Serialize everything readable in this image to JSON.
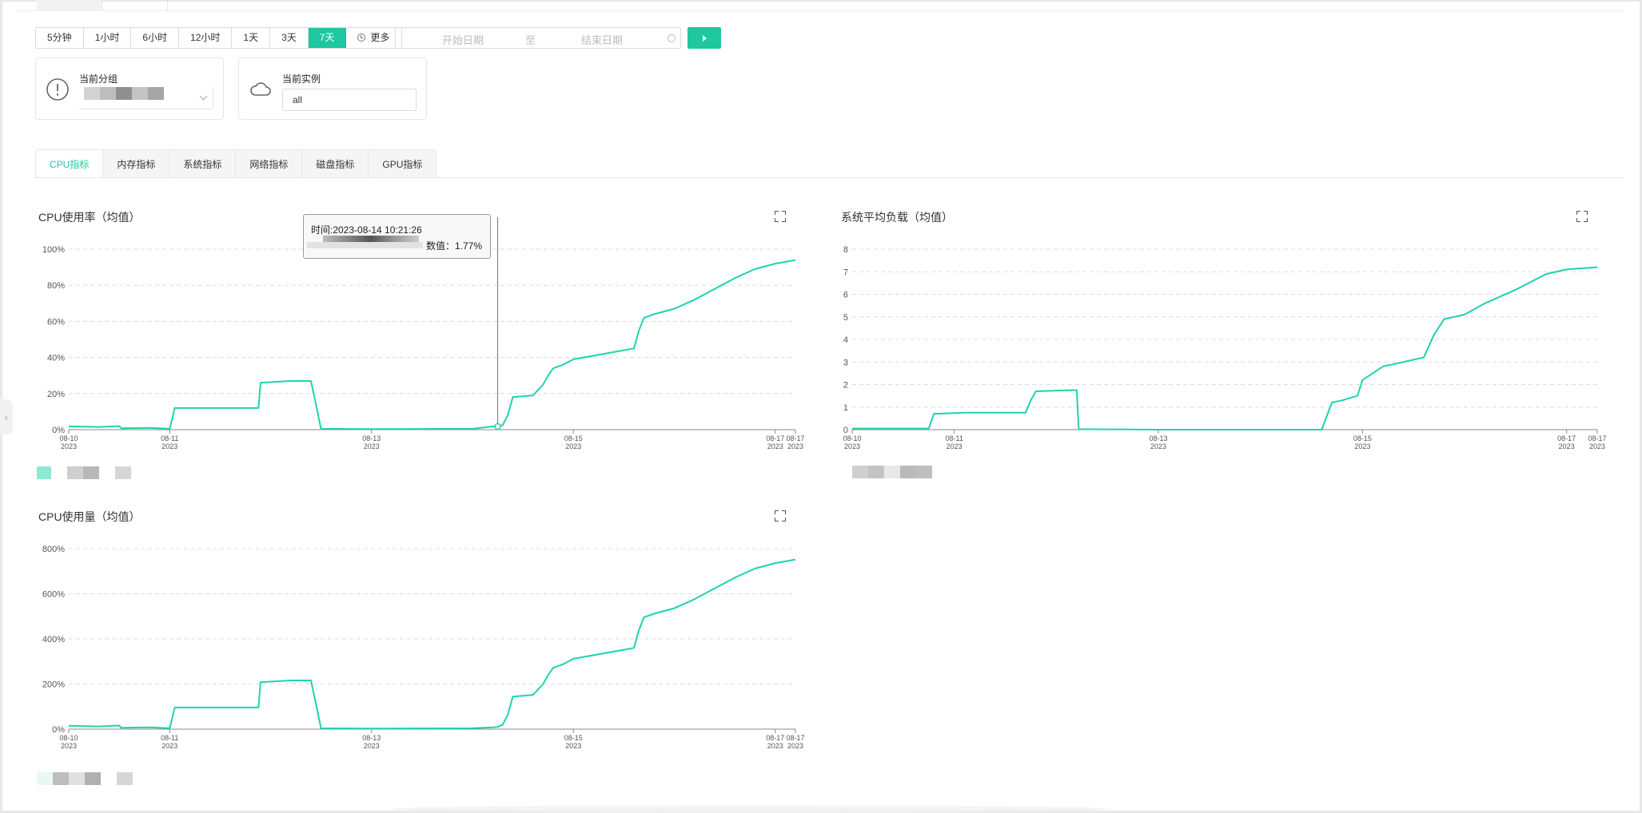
{
  "toolbar": {
    "ranges": [
      {
        "label": "5分钟",
        "active": false
      },
      {
        "label": "1小时",
        "active": false
      },
      {
        "label": "6小时",
        "active": false
      },
      {
        "label": "12小时",
        "active": false
      },
      {
        "label": "1天",
        "active": false
      },
      {
        "label": "3天",
        "active": false
      },
      {
        "label": "7天",
        "active": true
      }
    ],
    "more_label": "更多",
    "start_placeholder": "开始日期",
    "separator": "至",
    "end_placeholder": "结束日期"
  },
  "group_card": {
    "label": "当前分组"
  },
  "instance_card": {
    "label": "当前实例",
    "value": "all"
  },
  "tabs": [
    "CPU指标",
    "内存指标",
    "系统指标",
    "网络指标",
    "磁盘指标",
    "GPU指标"
  ],
  "colors": {
    "accent": "#1ec7a0",
    "line": "#1ed3ad"
  },
  "tooltip": {
    "time": "时间:2023-08-14 10:21:26",
    "value": "数值：1.77%"
  },
  "chart_data": [
    {
      "type": "line",
      "title": "CPU使用率（均值）",
      "yticks": [
        "0%",
        "20%",
        "40%",
        "60%",
        "80%",
        "100%"
      ],
      "ylim": [
        0,
        100
      ],
      "xticks": [
        {
          "day": 10,
          "date": "08-10",
          "year": "2023"
        },
        {
          "day": 11,
          "date": "08-11",
          "year": "2023"
        },
        {
          "day": 13,
          "date": "08-13",
          "year": "2023"
        },
        {
          "day": 15,
          "date": "08-15",
          "year": "2023"
        },
        {
          "day": 17,
          "date": "08-17",
          "year": "2023"
        },
        {
          "day": 17.2,
          "date": "08-17",
          "year": "2023"
        }
      ],
      "xlim": [
        10,
        17.2
      ],
      "x": [
        10.0,
        10.3,
        10.5,
        10.52,
        10.8,
        11.0,
        11.05,
        11.1,
        11.3,
        11.5,
        11.7,
        11.88,
        11.9,
        12.2,
        12.4,
        12.5,
        13.0,
        14.0,
        14.2,
        14.25,
        14.3,
        14.35,
        14.4,
        14.6,
        14.7,
        14.75,
        14.8,
        14.9,
        15.0,
        15.1,
        15.3,
        15.5,
        15.6,
        15.65,
        15.7,
        15.8,
        16.0,
        16.2,
        16.4,
        16.6,
        16.8,
        17.0,
        17.2
      ],
      "y": [
        1.8,
        1.5,
        2.0,
        0.8,
        1.0,
        0.5,
        12.0,
        12.0,
        12.0,
        12.0,
        12.0,
        12.0,
        26.0,
        27.0,
        27.0,
        0.5,
        0.3,
        0.5,
        1.77,
        1.77,
        2.5,
        8.0,
        18.0,
        19.0,
        25.0,
        30.0,
        34.0,
        36.0,
        39.0,
        40.0,
        42.0,
        44.0,
        45.0,
        55.0,
        62.0,
        64.0,
        67.0,
        72.0,
        78.0,
        84.0,
        89.0,
        92.0,
        94.0
      ]
    },
    {
      "type": "line",
      "title": "系统平均负载（均值）",
      "yticks": [
        "0",
        "1",
        "2",
        "3",
        "4",
        "5",
        "6",
        "7",
        "8"
      ],
      "ylim": [
        0,
        8
      ],
      "xticks": [
        {
          "day": 10,
          "date": "08-10",
          "year": "2023"
        },
        {
          "day": 11,
          "date": "08-11",
          "year": "2023"
        },
        {
          "day": 13,
          "date": "08-13",
          "year": "2023"
        },
        {
          "day": 15,
          "date": "08-15",
          "year": "2023"
        },
        {
          "day": 17,
          "date": "08-17",
          "year": "2023"
        },
        {
          "day": 17.3,
          "date": "08-17",
          "year": "2023"
        }
      ],
      "xlim": [
        10,
        17.3
      ],
      "x": [
        10.0,
        10.2,
        10.4,
        10.6,
        10.75,
        10.8,
        11.1,
        11.4,
        11.7,
        11.75,
        11.8,
        12.1,
        12.2,
        12.22,
        13.0,
        14.0,
        14.6,
        14.7,
        14.8,
        14.95,
        15.0,
        15.2,
        15.4,
        15.5,
        15.6,
        15.7,
        15.8,
        16.0,
        16.2,
        16.5,
        16.8,
        17.0,
        17.3
      ],
      "y": [
        0.05,
        0.05,
        0.05,
        0.05,
        0.05,
        0.7,
        0.75,
        0.75,
        0.75,
        1.3,
        1.7,
        1.75,
        1.75,
        0.02,
        0.0,
        0.0,
        0.0,
        1.2,
        1.3,
        1.5,
        2.2,
        2.8,
        3.0,
        3.1,
        3.2,
        4.2,
        4.9,
        5.1,
        5.6,
        6.2,
        6.9,
        7.1,
        7.2
      ]
    },
    {
      "type": "line",
      "title": "CPU使用量（均值）",
      "yticks": [
        "0%",
        "200%",
        "400%",
        "600%",
        "800%"
      ],
      "ylim": [
        0,
        800
      ],
      "xticks": [
        {
          "day": 10,
          "date": "08-10",
          "year": "2023"
        },
        {
          "day": 11,
          "date": "08-11",
          "year": "2023"
        },
        {
          "day": 13,
          "date": "08-13",
          "year": "2023"
        },
        {
          "day": 15,
          "date": "08-15",
          "year": "2023"
        },
        {
          "day": 17,
          "date": "08-17",
          "year": "2023"
        },
        {
          "day": 17.2,
          "date": "08-17",
          "year": "2023"
        }
      ],
      "xlim": [
        10,
        17.2
      ],
      "x": [
        10.0,
        10.3,
        10.5,
        10.52,
        10.8,
        11.0,
        11.05,
        11.1,
        11.3,
        11.5,
        11.7,
        11.88,
        11.9,
        12.2,
        12.4,
        12.5,
        13.0,
        14.0,
        14.2,
        14.25,
        14.3,
        14.35,
        14.4,
        14.6,
        14.7,
        14.75,
        14.8,
        14.9,
        15.0,
        15.1,
        15.3,
        15.5,
        15.6,
        15.65,
        15.7,
        15.8,
        16.0,
        16.2,
        16.4,
        16.6,
        16.8,
        17.0,
        17.2
      ],
      "y": [
        15,
        12,
        16,
        6,
        8,
        4,
        96,
        96,
        96,
        96,
        96,
        96,
        208,
        216,
        216,
        4,
        3,
        4,
        8,
        10,
        20,
        64,
        144,
        152,
        200,
        240,
        272,
        288,
        312,
        320,
        336,
        352,
        360,
        440,
        496,
        512,
        536,
        576,
        624,
        672,
        712,
        736,
        752
      ]
    }
  ]
}
